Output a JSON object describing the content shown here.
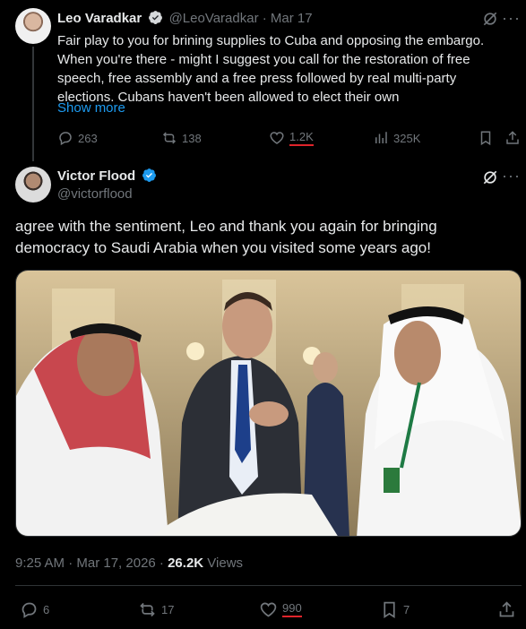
{
  "parent": {
    "name": "Leo Varadkar",
    "handle": "@LeoVaradkar",
    "sep": "·",
    "date": "Mar 17",
    "text": "Fair play to you for brining supplies to Cuba and opposing the embargo. When you're there - might I suggest you call for the restoration of free speech, free assembly and a free press followed by real multi-party elections.  Cubans haven't been allowed to elect their own",
    "show_more": "Show more",
    "replies": "263",
    "reposts": "138",
    "likes": "1.2K",
    "views": "325K"
  },
  "main": {
    "name": "Victor Flood",
    "handle": "@victorflood",
    "text": "agree with the sentiment, Leo and thank you again for bringing democracy to Saudi Arabia when you visited some years ago!",
    "timestamp": "9:25 AM · Mar 17, 2026 · ",
    "views_count": "26.2K",
    "views_label": " Views",
    "replies": "6",
    "reposts": "17",
    "likes": "990",
    "bookmarks": "7"
  },
  "colors": {
    "background": "#000000",
    "accent": "#1d9bf0",
    "muted": "#71767b",
    "annotation_underline": "#e0242b"
  }
}
